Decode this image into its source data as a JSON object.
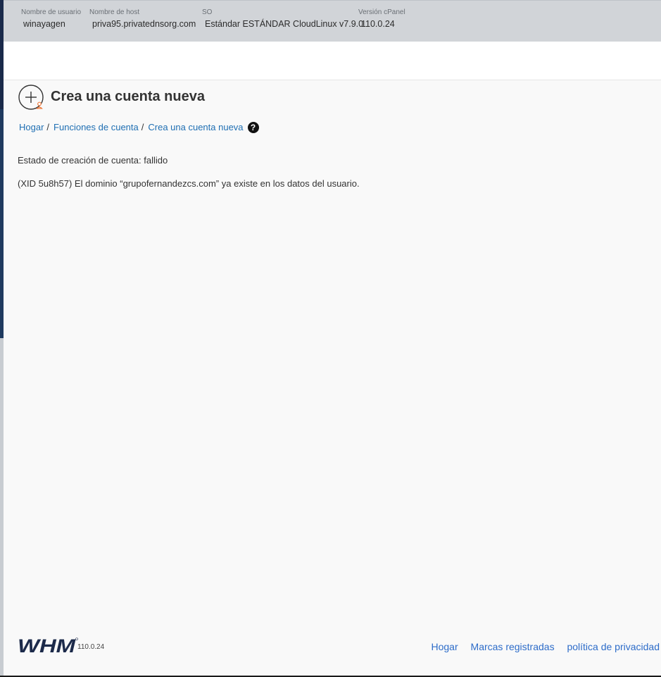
{
  "header": {
    "username_label": "Nombre de usuario",
    "username_value": "winayagen",
    "hostname_label": "Nombre de host",
    "hostname_value": "priva95.privatednsorg.com",
    "os_label": "SO",
    "os_value": "Estándar ESTÁNDAR CloudLinux v7.9.0",
    "cpanel_version_label": "Versión cPanel",
    "cpanel_version_value": "110.0.24"
  },
  "page": {
    "icon": "add-account-icon",
    "title": "Crea una cuenta nueva"
  },
  "breadcrumb": {
    "items": [
      "Hogar",
      "Funciones de cuenta",
      "Crea una cuenta nueva"
    ],
    "separator": "/",
    "help_icon": "question-circle-icon"
  },
  "main": {
    "status_text": "Estado de creación de cuenta: fallido",
    "error_text": "(XID 5u8h57) El dominio “grupofernandezcs.com” ya existe en los datos del usuario."
  },
  "footer": {
    "logo_text": "WHM",
    "version": "110.0.24",
    "links": [
      "Hogar",
      "Marcas registradas",
      "política de privacidad"
    ]
  },
  "colors": {
    "link": "#1f6fb3",
    "footer_link": "#2d6cc9",
    "topbar_bg": "#d1d4d8",
    "icon_accent": "#f07a3c"
  }
}
